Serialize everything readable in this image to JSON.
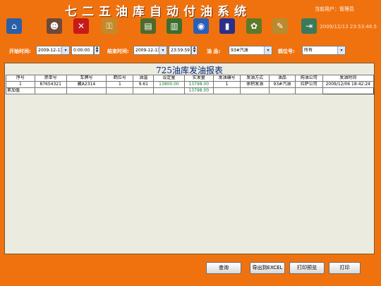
{
  "app": {
    "title": "七二五油库自动付油系统",
    "user_info": "当前用户：管理员",
    "datetime": "2009/12/13  23:53:48.5"
  },
  "toolbar": {
    "icons": [
      {
        "name": "home-icon",
        "color": "#2a5fa8",
        "glyph": "⌂"
      },
      {
        "name": "users-icon",
        "color": "#6b4a3a",
        "glyph": "☻"
      },
      {
        "name": "delete-icon",
        "color": "#c81a1a",
        "glyph": "✕"
      },
      {
        "name": "key-icon",
        "color": "#c28a2a",
        "glyph": "⚿"
      },
      {
        "name": "dispenser-icon",
        "color": "#4f6a2c",
        "glyph": "▤"
      },
      {
        "name": "truck-icon",
        "color": "#3c6e2e",
        "glyph": "▥"
      },
      {
        "name": "disc-icon",
        "color": "#2a5fb8",
        "glyph": "◉"
      },
      {
        "name": "bar-chart-icon",
        "color": "#2c2f8a",
        "glyph": "▮"
      },
      {
        "name": "settings-icon",
        "color": "#5c7a2a",
        "glyph": "✿"
      },
      {
        "name": "edit-icon",
        "color": "#b98a2e",
        "glyph": "✎"
      },
      {
        "name": "exit-icon",
        "color": "#3a7a5a",
        "glyph": "⇥"
      }
    ]
  },
  "filters": {
    "start_label": "开始时间:",
    "start_date": "2009-12-13",
    "start_time": "0:00:00",
    "end_label": "结束时间:",
    "end_date": "2009-12-13",
    "end_time": "23:59:59",
    "oil_label": "油  品:",
    "oil_value": "93#汽油",
    "crane_label": "鹤位号:",
    "crane_value": "所有"
  },
  "report": {
    "title": "725油库发油报表",
    "columns": [
      "序号",
      "票单号",
      "车牌号",
      "鹤位号",
      "油温",
      "设定量",
      "实发量",
      "发油编号",
      "发油方式",
      "油品",
      "购油公司",
      "发油时间"
    ],
    "rows": [
      [
        "1",
        "87654321",
        "藏A2314",
        "1",
        "9.61",
        "13800.00",
        "13798.00",
        "1",
        "体积发油",
        "93#汽油",
        "拉萨公司",
        "2009/12/06 18:42:24"
      ]
    ],
    "total_label": "累加值",
    "total_value": "13798.00"
  },
  "buttons": {
    "query": "查询",
    "export": "导出到EXCEL",
    "preview": "打印预览",
    "print": "打印"
  }
}
